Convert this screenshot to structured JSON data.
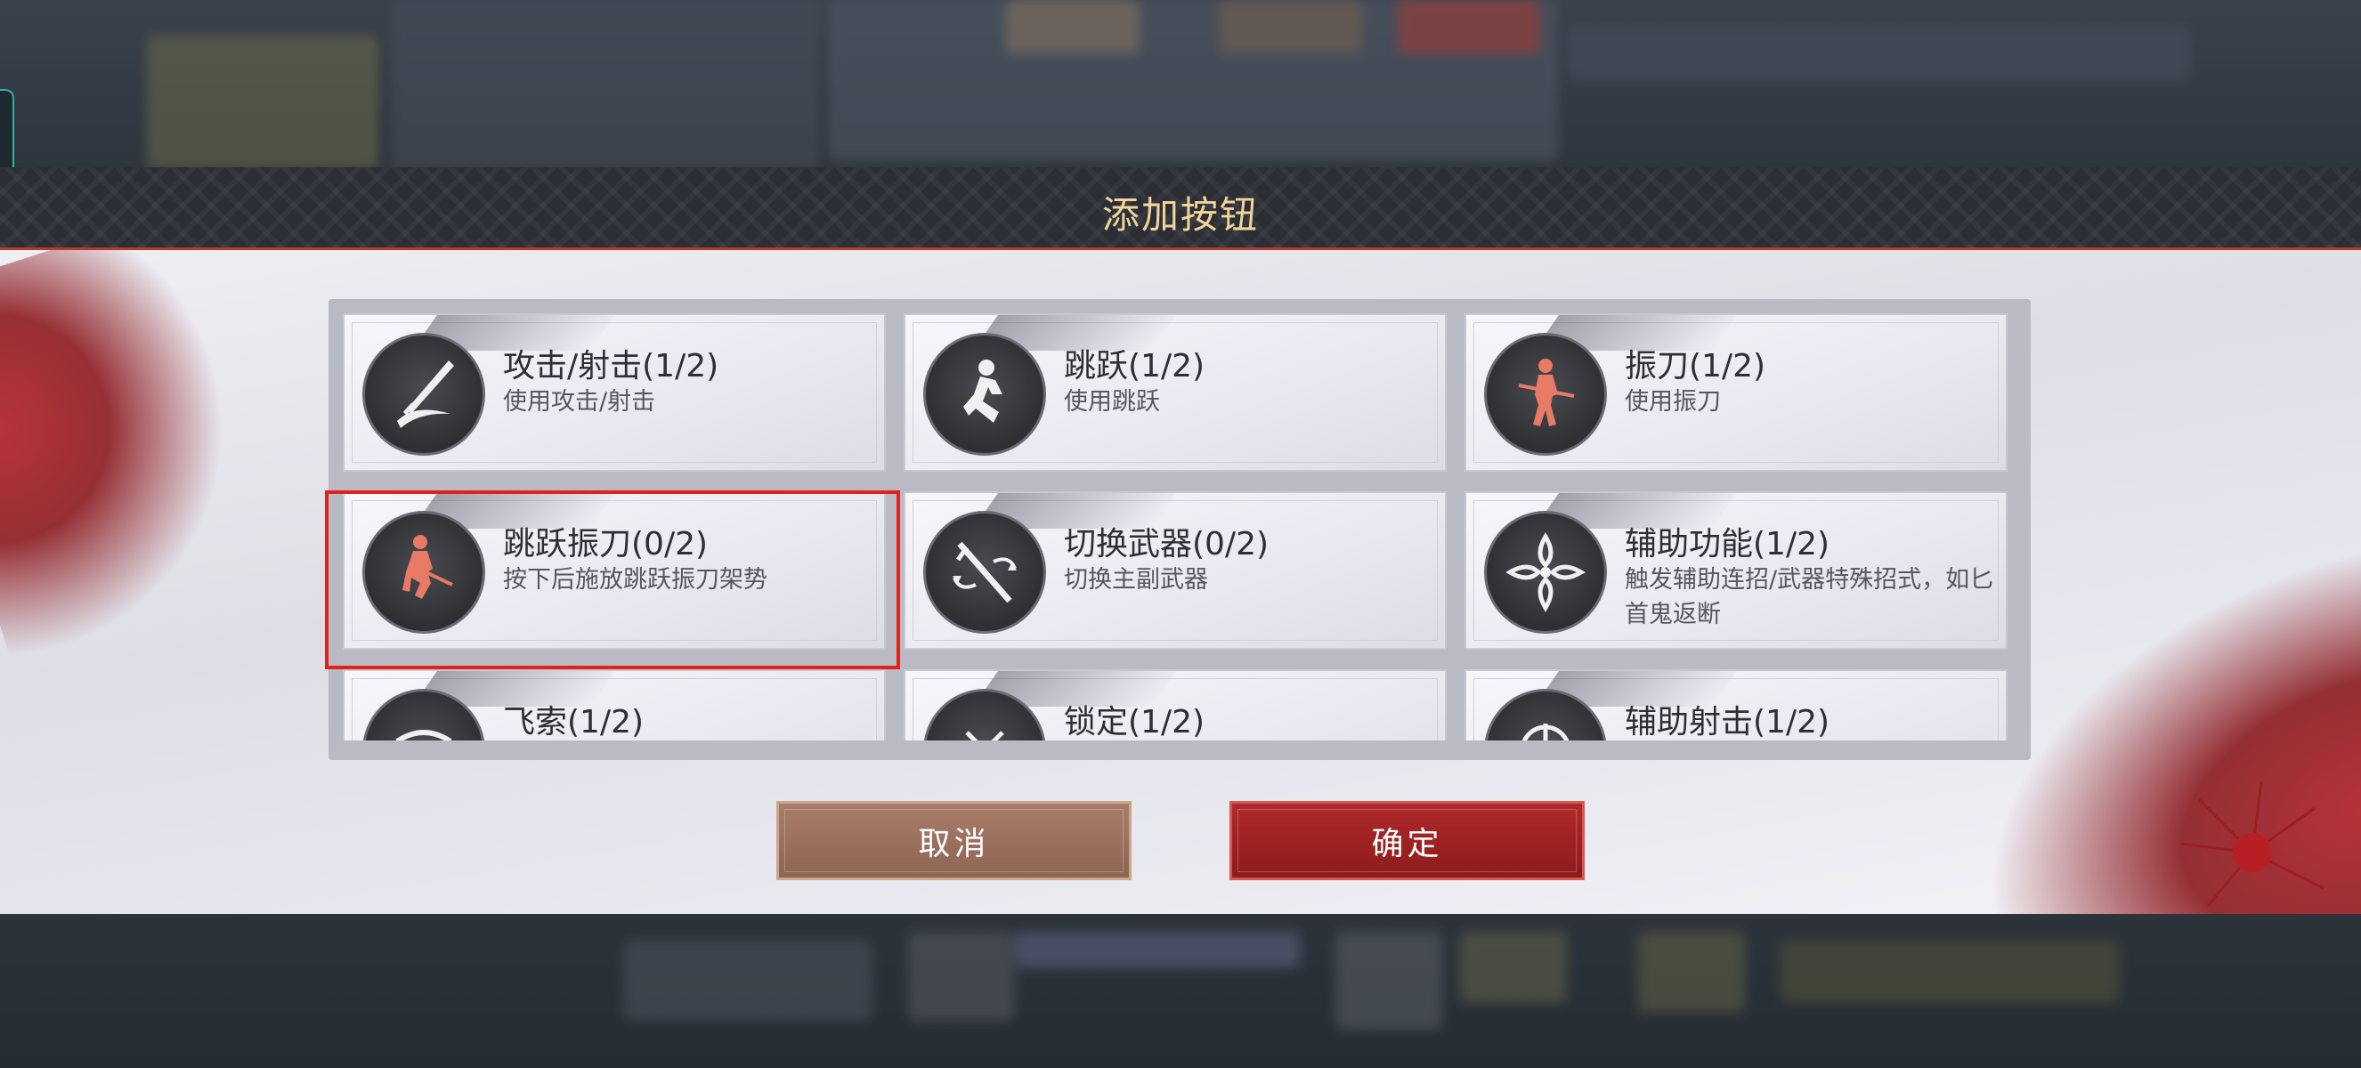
{
  "dialog": {
    "title": "添加按钮",
    "buttons": {
      "cancel": "取消",
      "confirm": "确定"
    }
  },
  "cards": [
    {
      "title": "攻击/射击(1/2)",
      "desc": "使用攻击/射击",
      "icon": "sword-slash-icon"
    },
    {
      "title": "跳跃(1/2)",
      "desc": "使用跳跃",
      "icon": "jump-figure-icon"
    },
    {
      "title": "振刀(1/2)",
      "desc": "使用振刀",
      "icon": "parry-figure-icon"
    },
    {
      "title": "跳跃振刀(0/2)",
      "desc": "按下后施放跳跃振刀架势",
      "icon": "jump-parry-figure-icon",
      "selected": true
    },
    {
      "title": "切换武器(0/2)",
      "desc": "切换主副武器",
      "icon": "swap-weapon-icon"
    },
    {
      "title": "辅助功能(1/2)",
      "desc": "触发辅助连招/武器特殊招式，如匕首鬼返断",
      "icon": "flower-emblem-icon"
    },
    {
      "title": "飞索(1/2)",
      "desc": "",
      "icon": "grapple-icon"
    },
    {
      "title": "锁定(1/2)",
      "desc": "",
      "icon": "lock-on-icon"
    },
    {
      "title": "辅助射击(1/2)",
      "desc": "",
      "icon": "aim-assist-icon"
    }
  ],
  "colors": {
    "highlight": "#e0211c",
    "accent_red": "#b0292a",
    "title_gold": "#f2d49a",
    "icon_figure": "#e87a66"
  }
}
